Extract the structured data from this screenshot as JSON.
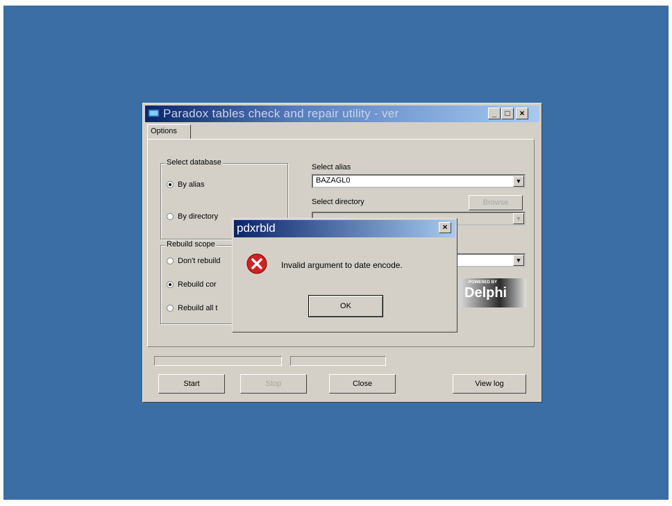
{
  "main_window": {
    "title": "Paradox tables check and repair utility - ver",
    "minimize": "_",
    "maximize": "□",
    "close": "×",
    "tab_label": "Options",
    "select_database": {
      "title": "Select database",
      "by_alias": "By alias",
      "by_directory": "By directory"
    },
    "select_alias": {
      "label": "Select alias",
      "value": "BAZAGL0"
    },
    "select_directory": {
      "label": "Select directory",
      "browse": "Browse"
    },
    "rebuild_scope": {
      "title": "Rebuild scope",
      "dont_rebuild": "Don't rebuild",
      "rebuild_corrupted": "Rebuild cor",
      "rebuild_all": "Rebuild all t"
    },
    "logo_text": "Delphi",
    "logo_small": "POWERED BY",
    "buttons": {
      "start": "Start",
      "stop": "Stop",
      "close": "Close",
      "view_log": "View log"
    }
  },
  "dialog": {
    "title": "pdxrbld",
    "message": "Invalid argument to date encode.",
    "ok": "OK",
    "close": "×"
  },
  "colors": {
    "desktop": "#3a6ea5",
    "window": "#d4d0c8",
    "titlebar": "#0a246a",
    "error": "#d42020"
  }
}
